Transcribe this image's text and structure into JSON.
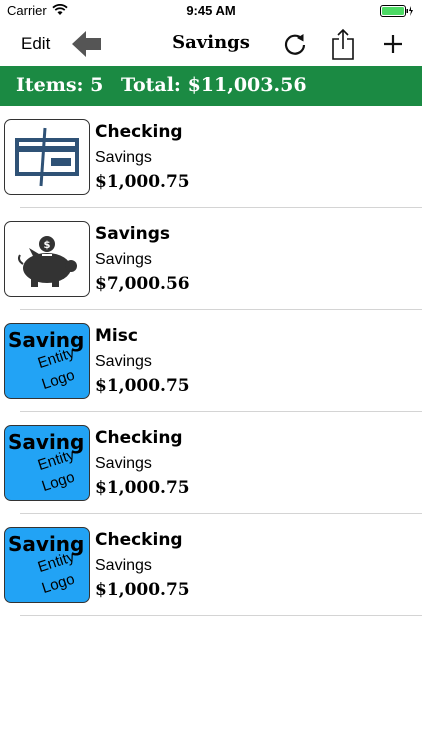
{
  "status_bar": {
    "carrier": "Carrier",
    "time": "9:45 AM"
  },
  "nav": {
    "edit_label": "Edit",
    "title": "Savings",
    "icons": {
      "back": "back-arrow-icon",
      "refresh": "refresh-icon",
      "share": "share-icon",
      "add": "plus-icon"
    }
  },
  "summary": {
    "items_text": "Items: 5",
    "total_text": "Total: $11,003.56"
  },
  "accounts": [
    {
      "title": "Checking",
      "subtitle": "Savings",
      "amount": "$1,000.75",
      "icon": "check-icon"
    },
    {
      "title": "Savings",
      "subtitle": "Savings",
      "amount": "$7,000.56",
      "icon": "piggy-bank-icon"
    },
    {
      "title": "Misc",
      "subtitle": "Savings",
      "amount": "$1,000.75",
      "icon": "entity-logo"
    },
    {
      "title": "Checking",
      "subtitle": "Savings",
      "amount": "$1,000.75",
      "icon": "entity-logo"
    },
    {
      "title": "Checking",
      "subtitle": "Savings",
      "amount": "$1,000.75",
      "icon": "entity-logo"
    }
  ],
  "entity_logo": {
    "line1": "Saving",
    "line2": "Entity",
    "line3": "Logo"
  },
  "colors": {
    "banner": "#1b8a43",
    "logo_bg": "#22a3f5",
    "battery": "#4cd964"
  }
}
